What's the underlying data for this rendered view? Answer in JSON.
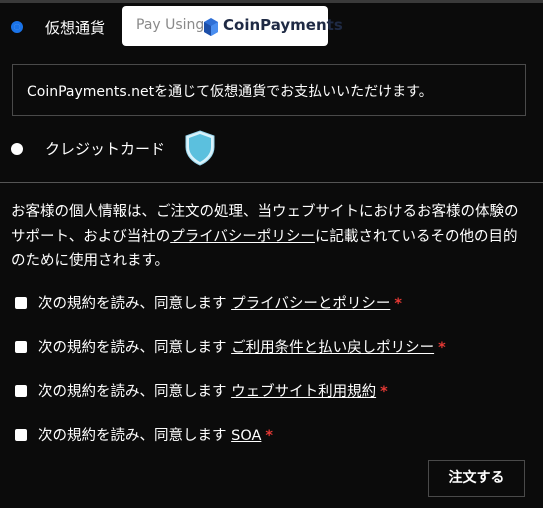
{
  "payment": {
    "crypto_label": "仮想通貨",
    "crypto_selected": true,
    "badge_prefix": "Pay Using",
    "badge_brand": "CoinPayments",
    "crypto_info": "CoinPayments.netを通じて仮想通貨でお支払いいただけます。",
    "card_label": "クレジットカード",
    "card_selected": false
  },
  "privacy": {
    "text_before": "お客様の個人情報は、ご注文の処理、当ウェブサイトにおけるお客様の体験のサポート、および当社の",
    "link": "プライバシーポリシー",
    "text_after": "に記載されているその他の目的のために使用されます。"
  },
  "agreements": [
    {
      "prefix": "次の規約を読み、同意します",
      "link": "プライバシーとポリシー",
      "required": "*",
      "checked": false
    },
    {
      "prefix": "次の規約を読み、同意します",
      "link": "ご利用条件と払い戻しポリシー",
      "required": "*",
      "checked": false
    },
    {
      "prefix": "次の規約を読み、同意します",
      "link": "ウェブサイト利用規約",
      "required": "*",
      "checked": false
    },
    {
      "prefix": "次の規約を読み、同意します",
      "link": "SOA",
      "required": "*",
      "checked": false
    }
  ],
  "order_button": "注文する",
  "colors": {
    "background": "#0b0b0b",
    "radio_selected": "#1a73e8",
    "required": "#e53935",
    "shield": "#5bc0de"
  }
}
